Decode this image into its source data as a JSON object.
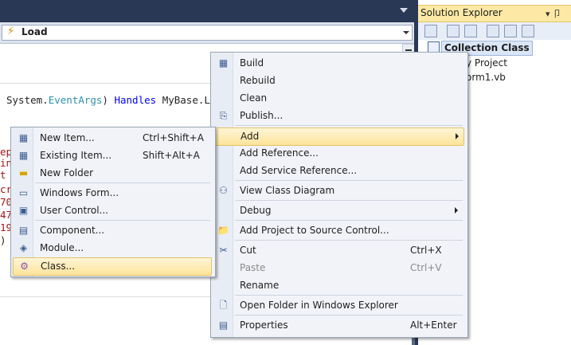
{
  "event_combo": {
    "selected": "Load"
  },
  "code": {
    "prefix": "System.",
    "type": "EventArgs",
    "close": ") ",
    "handles": "Handles",
    "mybase": " MyBase.Load",
    "fragments": [
      "ep",
      "in",
      "t",
      "cr",
      "70",
      "47",
      "19",
      ")"
    ]
  },
  "solution_explorer": {
    "title": "Solution Explorer",
    "pin": "▾ 卩",
    "project": "Collection Class",
    "items": [
      "y Project",
      "orm1.vb"
    ]
  },
  "main_menu": [
    {
      "label": "Build",
      "icon": "build-icon"
    },
    {
      "label": "Rebuild"
    },
    {
      "label": "Clean"
    },
    {
      "label": "Publish...",
      "icon": "publish-icon"
    },
    {
      "label": "Add",
      "submenu": true
    },
    {
      "label": "Add Reference..."
    },
    {
      "label": "Add Service Reference..."
    },
    {
      "label": "View Class Diagram",
      "icon": "class-diagram-icon"
    },
    {
      "label": "Debug",
      "submenu": true
    },
    {
      "label": "Add Project to Source Control...",
      "icon": "source-control-icon"
    },
    {
      "label": "Cut",
      "shortcut": "Ctrl+X",
      "icon": "cut-icon"
    },
    {
      "label": "Paste",
      "shortcut": "Ctrl+V",
      "disabled": true
    },
    {
      "label": "Rename"
    },
    {
      "label": "Open Folder in Windows Explorer",
      "icon": "open-folder-icon"
    },
    {
      "label": "Properties",
      "shortcut": "Alt+Enter",
      "icon": "properties-icon"
    }
  ],
  "add_submenu": [
    {
      "label": "New Item...",
      "shortcut": "Ctrl+Shift+A",
      "icon": "new-item-icon"
    },
    {
      "label": "Existing Item...",
      "shortcut": "Shift+Alt+A",
      "icon": "existing-item-icon"
    },
    {
      "label": "New Folder",
      "icon": "folder-icon"
    },
    {
      "label": "Windows Form...",
      "icon": "windows-form-icon"
    },
    {
      "label": "User Control...",
      "icon": "user-control-icon"
    },
    {
      "label": "Component...",
      "icon": "component-icon"
    },
    {
      "label": "Module...",
      "icon": "module-icon"
    },
    {
      "label": "Class...",
      "icon": "class-icon"
    }
  ],
  "colors": {
    "highlight": "#fde49a",
    "chrome": "#293955",
    "solution_header": "#fde9a5"
  }
}
